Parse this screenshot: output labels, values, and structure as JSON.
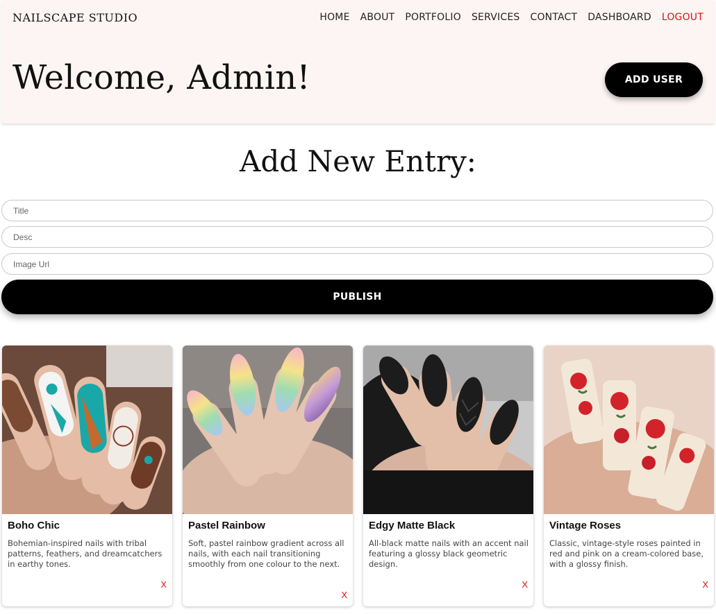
{
  "brand": "NAILSCAPE STUDIO",
  "nav": [
    "HOME",
    "ABOUT",
    "PORTFOLIO",
    "SERVICES",
    "CONTACT",
    "DASHBOARD",
    "LOGOUT"
  ],
  "welcome": "Welcome, Admin!",
  "add_user_label": "ADD USER",
  "form": {
    "title": "Add New Entry:",
    "title_placeholder": "Title",
    "desc_placeholder": "Desc",
    "image_placeholder": "Image Url",
    "publish_label": "PUBLISH"
  },
  "cards": [
    {
      "title": "Boho Chic",
      "desc": "Bohemian-inspired nails with tribal patterns, feathers, and dreamcatchers in earthy tones.",
      "delete": "X"
    },
    {
      "title": "Pastel Rainbow",
      "desc": "Soft, pastel rainbow gradient across all nails, with each nail transitioning smoothly from one colour to the next.",
      "delete": "X"
    },
    {
      "title": "Edgy Matte Black",
      "desc": "All-black matte nails with an accent nail featuring a glossy black geometric design.",
      "delete": "X"
    },
    {
      "title": "Vintage Roses",
      "desc": "Classic, vintage-style roses painted in red and pink on a cream-colored base, with a glossy finish.",
      "delete": "X"
    }
  ],
  "colors": {
    "header_bg": "#fdf5f4",
    "logout": "#e01010",
    "button_bg": "#000000"
  }
}
